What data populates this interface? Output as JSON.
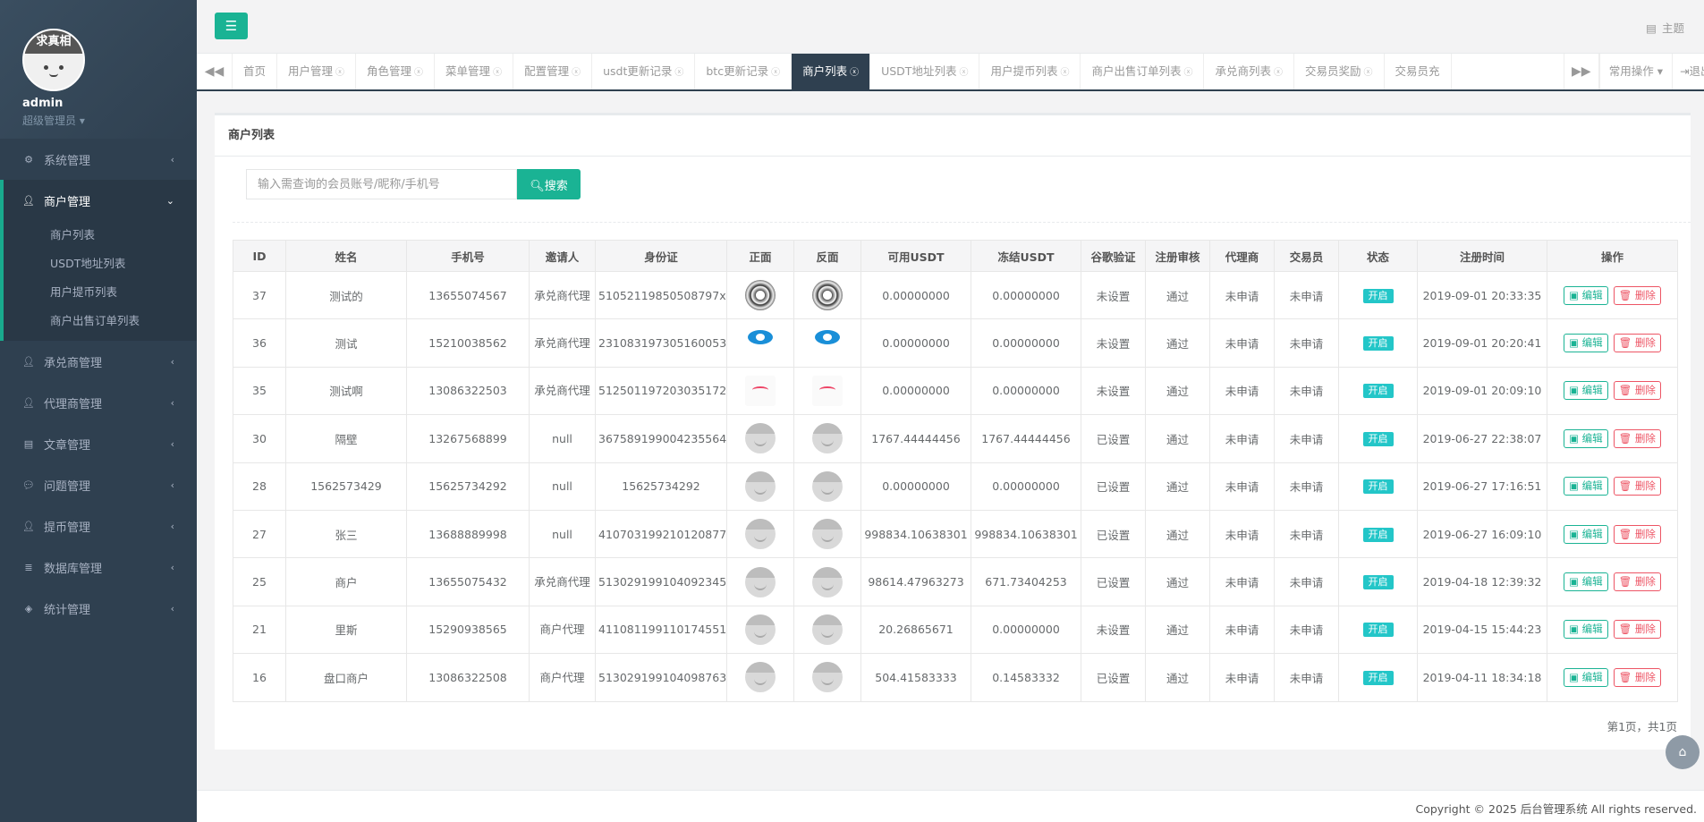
{
  "sidebar": {
    "avatar_text": "求真相",
    "username": "admin",
    "role": "超级管理员",
    "menu": [
      {
        "label": "系统管理",
        "icon": "gear-icon"
      },
      {
        "label": "商户管理",
        "icon": "user-icon",
        "active": true,
        "children": [
          "商户列表",
          "USDT地址列表",
          "用户提币列表",
          "商户出售订单列表"
        ]
      },
      {
        "label": "承兑商管理",
        "icon": "user-icon"
      },
      {
        "label": "代理商管理",
        "icon": "user-icon"
      },
      {
        "label": "文章管理",
        "icon": "document-icon"
      },
      {
        "label": "问题管理",
        "icon": "comment-icon"
      },
      {
        "label": "提币管理",
        "icon": "user-icon"
      },
      {
        "label": "数据库管理",
        "icon": "database-icon"
      },
      {
        "label": "统计管理",
        "icon": "cube-icon"
      }
    ]
  },
  "header": {
    "theme_label": "主题"
  },
  "tabs": [
    {
      "label": "首页",
      "closable": false
    },
    {
      "label": "用户管理",
      "closable": true
    },
    {
      "label": "角色管理",
      "closable": true
    },
    {
      "label": "菜单管理",
      "closable": true
    },
    {
      "label": "配置管理",
      "closable": true
    },
    {
      "label": "usdt更新记录",
      "closable": true
    },
    {
      "label": "btc更新记录",
      "closable": true
    },
    {
      "label": "商户列表",
      "closable": true,
      "active": true
    },
    {
      "label": "USDT地址列表",
      "closable": true
    },
    {
      "label": "用户提币列表",
      "closable": true
    },
    {
      "label": "商户出售订单列表",
      "closable": true
    },
    {
      "label": "承兑商列表",
      "closable": true
    },
    {
      "label": "交易员奖励",
      "closable": true
    },
    {
      "label": "交易员充",
      "closable": false
    }
  ],
  "tab_ops": {
    "common_label": "常用操作",
    "logout_label": "退出"
  },
  "panel": {
    "title": "商户列表",
    "search": {
      "placeholder": "输入需查询的会员账号/昵称/手机号",
      "button": "搜索"
    },
    "columns": [
      "ID",
      "姓名",
      "手机号",
      "邀请人",
      "身份证",
      "正面",
      "反面",
      "可用USDT",
      "冻结USDT",
      "谷歌验证",
      "注册审核",
      "代理商",
      "交易员",
      "状态",
      "注册时间",
      "操作"
    ],
    "rows": [
      {
        "id": "37",
        "name": "测试的",
        "phone": "13655074567",
        "inviter": "承兑商代理",
        "idcard": "51052119850508797x",
        "img": "dark",
        "usdt": "0.00000000",
        "frozen": "0.00000000",
        "google": "未设置",
        "audit": "通过",
        "agent": "未申请",
        "trader": "未申请",
        "status": "开启",
        "time": "2019-09-01 20:33:35"
      },
      {
        "id": "36",
        "name": "测试",
        "phone": "15210038562",
        "inviter": "承兑商代理",
        "idcard": "231083197305160053",
        "img": "blue",
        "usdt": "0.00000000",
        "frozen": "0.00000000",
        "google": "未设置",
        "audit": "通过",
        "agent": "未申请",
        "trader": "未申请",
        "status": "开启",
        "time": "2019-09-01 20:20:41"
      },
      {
        "id": "35",
        "name": "测试啊",
        "phone": "13086322503",
        "inviter": "承兑商代理",
        "idcard": "512501197203035172",
        "img": "red",
        "usdt": "0.00000000",
        "frozen": "0.00000000",
        "google": "未设置",
        "audit": "通过",
        "agent": "未申请",
        "trader": "未申请",
        "status": "开启",
        "time": "2019-09-01 20:09:10"
      },
      {
        "id": "30",
        "name": "隔壁",
        "phone": "13267568899",
        "inviter": "null",
        "idcard": "367589199004235564",
        "img": "grey",
        "usdt": "1767.44444456",
        "frozen": "1767.44444456",
        "google": "已设置",
        "audit": "通过",
        "agent": "未申请",
        "trader": "未申请",
        "status": "开启",
        "time": "2019-06-27 22:38:07"
      },
      {
        "id": "28",
        "name": "1562573429",
        "phone": "15625734292",
        "inviter": "null",
        "idcard": "15625734292",
        "img": "grey",
        "usdt": "0.00000000",
        "frozen": "0.00000000",
        "google": "已设置",
        "audit": "通过",
        "agent": "未申请",
        "trader": "未申请",
        "status": "开启",
        "time": "2019-06-27 17:16:51"
      },
      {
        "id": "27",
        "name": "张三",
        "phone": "13688889998",
        "inviter": "null",
        "idcard": "410703199210120877",
        "img": "grey",
        "usdt": "998834.10638301",
        "frozen": "998834.10638301",
        "google": "已设置",
        "audit": "通过",
        "agent": "未申请",
        "trader": "未申请",
        "status": "开启",
        "time": "2019-06-27 16:09:10"
      },
      {
        "id": "25",
        "name": "商户",
        "phone": "13655075432",
        "inviter": "承兑商代理",
        "idcard": "513029199104092345",
        "img": "grey",
        "usdt": "98614.47963273",
        "frozen": "671.73404253",
        "google": "已设置",
        "audit": "通过",
        "agent": "未申请",
        "trader": "未申请",
        "status": "开启",
        "time": "2019-04-18 12:39:32"
      },
      {
        "id": "21",
        "name": "里斯",
        "phone": "15290938565",
        "inviter": "商户代理",
        "idcard": "411081199110174551",
        "img": "grey",
        "usdt": "20.26865671",
        "frozen": "0.00000000",
        "google": "未设置",
        "audit": "通过",
        "agent": "未申请",
        "trader": "未申请",
        "status": "开启",
        "time": "2019-04-15 15:44:23"
      },
      {
        "id": "16",
        "name": "盘口商户",
        "phone": "13086322508",
        "inviter": "商户代理",
        "idcard": "513029199104098763",
        "img": "grey",
        "usdt": "504.41583333",
        "frozen": "0.14583332",
        "google": "已设置",
        "audit": "通过",
        "agent": "未申请",
        "trader": "未申请",
        "status": "开启",
        "time": "2019-04-11 18:34:18"
      }
    ],
    "edit_label": "编辑",
    "delete_label": "删除",
    "pagination": "第1页，共1页"
  },
  "footer": {
    "copyright": "Copyright © 2025 后台管理系统 All rights reserved."
  },
  "colors": {
    "accent": "#1ab394",
    "sidebar_bg": "#2f4050",
    "danger": "#ed5565",
    "badge": "#23c6c8"
  }
}
